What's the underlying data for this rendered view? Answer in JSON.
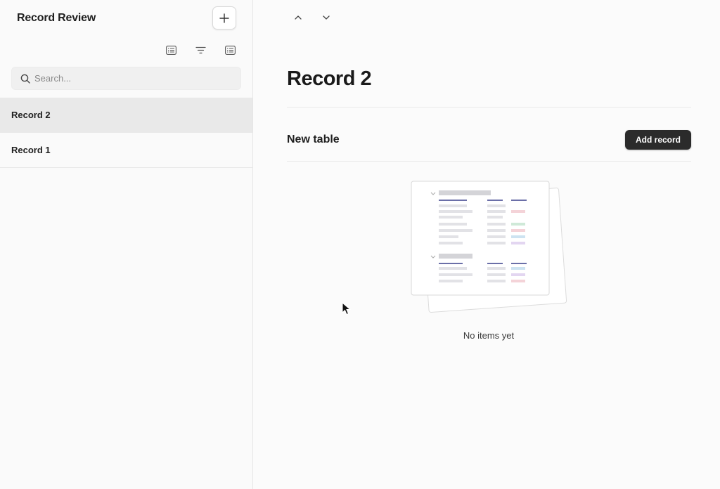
{
  "sidebar": {
    "title": "Record Review",
    "add_icon": "plus-icon",
    "tools": [
      "list-icon",
      "filter-icon",
      "list-icon"
    ],
    "search": {
      "placeholder": "Search...",
      "value": "",
      "icon": "search-icon"
    },
    "records": [
      {
        "label": "Record 2",
        "active": true
      },
      {
        "label": "Record 1",
        "active": false
      }
    ]
  },
  "main": {
    "nav": {
      "prev_icon": "chevron-up-icon",
      "next_icon": "chevron-down-icon"
    },
    "title": "Record 2",
    "section": {
      "title": "New table",
      "add_record_label": "Add record",
      "empty_text": "No items yet"
    }
  },
  "colors": {
    "primary_button": "#2b2b2b",
    "selected_row": "#e9e9e9",
    "illustration_accent": "#6b6fa8"
  }
}
